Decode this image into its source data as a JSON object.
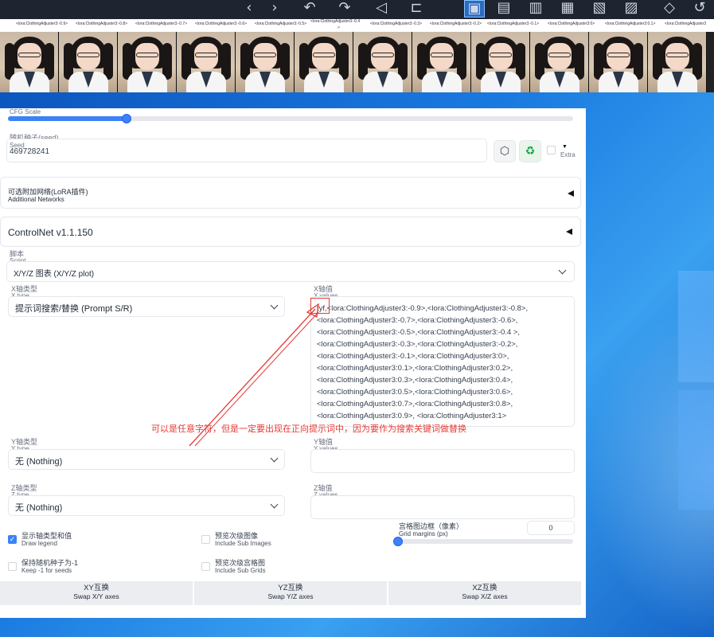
{
  "toolbar": {
    "icons": [
      "back-icon",
      "forward-icon",
      "undo-icon",
      "redo-icon",
      "send-icon",
      "crop-icon",
      "save-icon",
      "copy-icon",
      "save-zip-icon",
      "image-icon",
      "image-grid-icon",
      "folder-icon",
      "shape-icon",
      "refresh-icon"
    ]
  },
  "strip": {
    "labels": [
      "<lora:ClothingAdjuster3:-0.9>",
      "<lora:ClothingAdjuster3:-0.8>",
      "<lora:ClothingAdjuster3:-0.7>",
      "<lora:ClothingAdjuster3:-0.6>",
      "<lora:ClothingAdjuster3:-0.5>",
      "<lora:ClothingAdjuster3:-0.4",
      "<lora:ClothingAdjuster3:-0.3>",
      "<lora:ClothingAdjuster3:-0.2>",
      "<lora:ClothingAdjuster3:-0.1>",
      "<lora:ClothingAdjuster3:0>",
      "<lora:ClothingAdjuster3:0.1>",
      "<lora:ClothingAdjuster3"
    ],
    "label_suffix": ">"
  },
  "cfg": {
    "label": "CFG Scale",
    "value_fraction": 0.21
  },
  "seed": {
    "label_zh": "随机种子(seed)",
    "label_en": "Seed",
    "value": "469728241",
    "extra_label": "Extra",
    "extra_arrow": "▼"
  },
  "lora_section": {
    "title_zh": "可选附加网络(LoRA插件)",
    "title_en": "Additional Networks"
  },
  "controlnet": {
    "title": "ControlNet v1.1.150"
  },
  "script": {
    "label_zh": "脚本",
    "label_en": "Script",
    "value": "X/Y/Z 图表 (X/Y/Z plot)"
  },
  "x_type": {
    "label_zh": "X轴类型",
    "label_en": "X type",
    "value": "提示词搜索/替换 (Prompt S/R)"
  },
  "x_values": {
    "label_zh": "X轴值",
    "label_en": "X values",
    "lines": [
      "tyf,<lora:ClothingAdjuster3:-0.9>,<lora:ClothingAdjuster3:-0.8>,",
      "<lora:ClothingAdjuster3:-0.7>,<lora:ClothingAdjuster3:-0.6>,",
      "<lora:ClothingAdjuster3:-0.5>,<lora:ClothingAdjuster3:-0.4 >,",
      "<lora:ClothingAdjuster3:-0.3>,<lora:ClothingAdjuster3:-0.2>,",
      "<lora:ClothingAdjuster3:-0.1>,<lora:ClothingAdjuster3:0>,",
      "<lora:ClothingAdjuster3:0.1>,<lora:ClothingAdjuster3:0.2>,",
      "<lora:ClothingAdjuster3:0.3>,<lora:ClothingAdjuster3:0.4>,",
      "<lora:ClothingAdjuster3:0.5>,<lora:ClothingAdjuster3:0.6>,",
      "<lora:ClothingAdjuster3:0.7>,<lora:ClothingAdjuster3:0.8>,",
      "<lora:ClothingAdjuster3:0.9>, <lora:ClothingAdjuster3:1>"
    ]
  },
  "annotation": "可以是任意字符，但是一定要出现在正向提示词中，因为要作为搜索关键词做替换",
  "y_type": {
    "label_zh": "Y轴类型",
    "label_en": "Y type",
    "value": "无 (Nothing)"
  },
  "y_values": {
    "label_zh": "Y轴值",
    "label_en": "Y values",
    "value": ""
  },
  "z_type": {
    "label_zh": "Z轴类型",
    "label_en": "Z type",
    "value": "无 (Nothing)"
  },
  "z_values": {
    "label_zh": "Z轴值",
    "label_en": "Z values",
    "value": ""
  },
  "options": {
    "draw_legend": {
      "zh": "显示轴类型和值",
      "en": "Draw legend",
      "checked": true,
      "mark": "✓"
    },
    "include_sub_images": {
      "zh": "预览次级图像",
      "en": "Include Sub Images",
      "checked": false
    },
    "keep_seeds": {
      "zh": "保持随机种子为-1",
      "en": "Keep -1 for seeds",
      "checked": false
    },
    "include_sub_grids": {
      "zh": "预览次级宫格图",
      "en": "Include Sub Grids",
      "checked": false
    }
  },
  "grid_margins": {
    "label_zh": "宫格图边框（像素）",
    "label_en": "Grid margins (px)",
    "value": "0",
    "value_fraction": 0.0
  },
  "swap": {
    "xy": {
      "zh": "XY互换",
      "en": "Swap X/Y axes"
    },
    "yz": {
      "zh": "YZ互换",
      "en": "Swap Y/Z axes"
    },
    "xz": {
      "zh": "XZ互换",
      "en": "Swap X/Z axes"
    }
  },
  "colors": {
    "accent": "#3b82f6",
    "annotation": "#e53935",
    "toolbar_bg": "#1e2430"
  }
}
